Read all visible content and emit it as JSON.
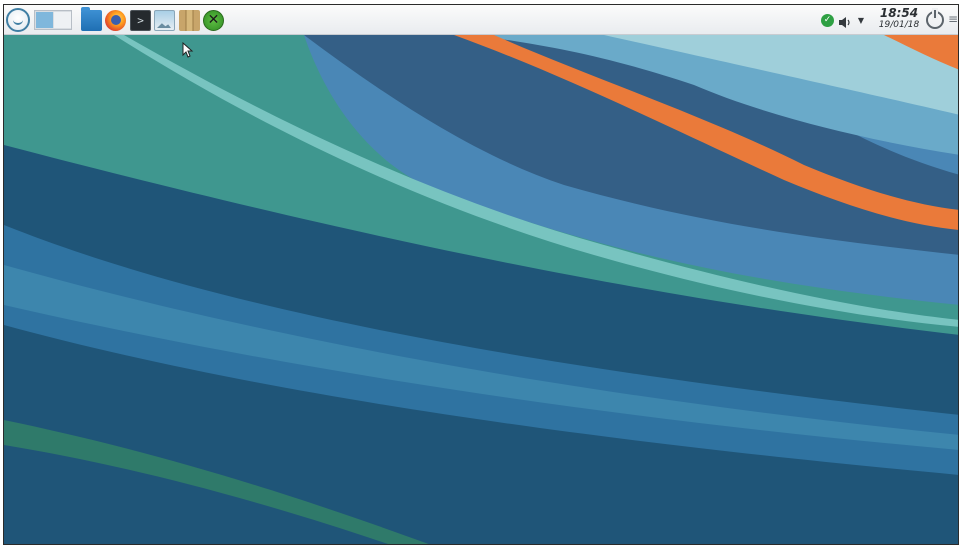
{
  "taskbar": {
    "launcher_icon": "app-launcher-icon",
    "pager_icon": "virtual-desktop-pager",
    "tasks": [
      {
        "icon": "folder-icon",
        "label": ""
      },
      {
        "icon": "firefox-icon",
        "label": ""
      },
      {
        "icon": "terminal-icon",
        "label": ""
      },
      {
        "icon": "image-viewer-icon",
        "label": ""
      },
      {
        "icon": "library-icon",
        "label": ""
      },
      {
        "icon": "xbox-icon",
        "label": ""
      }
    ],
    "terminal_glyph": ">",
    "xbox_glyph": "✕"
  },
  "tray": {
    "update_icon": "check-circle-icon",
    "update_glyph": "✓",
    "volume_icon": "speaker-icon",
    "expand_icon": "triangle-down-icon",
    "expand_glyph": "▼",
    "power_icon": "power-icon",
    "menu_icon": "hamburger-icon",
    "menu_glyph": "≡"
  },
  "clock": {
    "time": "18:54",
    "date": "19/01/18"
  },
  "colors": {
    "panel": "#f2f4f6",
    "wallpaper_dark": "#1e5578",
    "wallpaper_teal": "#3f9890",
    "wallpaper_light": "#86c4d3",
    "wallpaper_orange": "#ea7a3a"
  }
}
